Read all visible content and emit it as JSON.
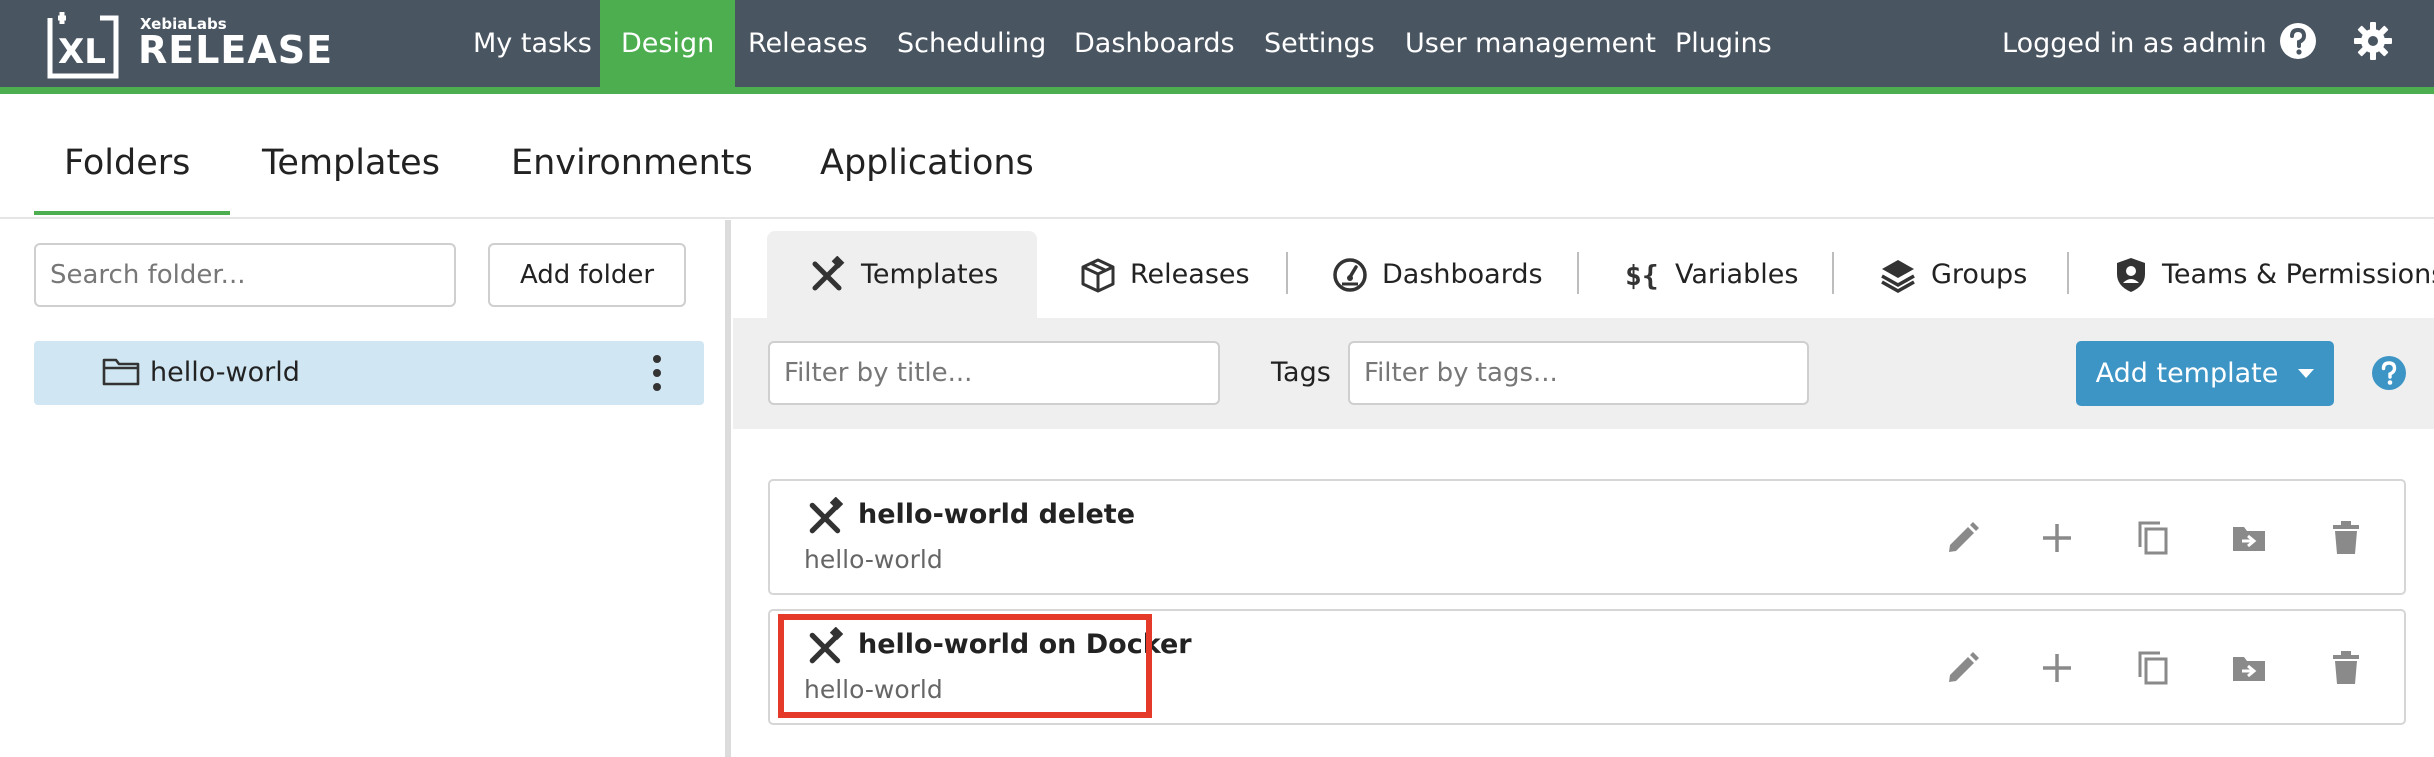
{
  "app": {
    "brand_small": "XebiaLabs",
    "brand_big": "RELEASE",
    "logo_mark_text": "XL"
  },
  "nav": {
    "items": [
      "My tasks",
      "Design",
      "Releases",
      "Scheduling",
      "Dashboards",
      "Settings",
      "User management",
      "Plugins"
    ],
    "active": "Design",
    "logged_in": "Logged in as admin"
  },
  "main_tabs": {
    "items": [
      "Folders",
      "Templates",
      "Environments",
      "Applications"
    ],
    "active": "Folders"
  },
  "left": {
    "search_placeholder": "Search folder...",
    "add_folder_label": "Add folder",
    "folders": [
      {
        "name": "hello-world",
        "selected": true
      }
    ]
  },
  "sub_tabs": {
    "items": [
      "Templates",
      "Releases",
      "Dashboards",
      "Variables",
      "Groups",
      "Teams & Permissions"
    ],
    "active": "Templates"
  },
  "filters": {
    "title_placeholder": "Filter by title...",
    "tags_label": "Tags",
    "tags_placeholder": "Filter by tags...",
    "add_template_label": "Add template"
  },
  "templates": [
    {
      "title": "hello-world delete",
      "folder": "hello-world"
    },
    {
      "title": "hello-world on Docker",
      "folder": "hello-world"
    }
  ],
  "colors": {
    "topbar": "#4a5562",
    "accent_green": "#4cae4f",
    "selected_folder": "#d0e6f3",
    "primary_button": "#3d95c6",
    "highlight_red": "#e53a2a"
  }
}
